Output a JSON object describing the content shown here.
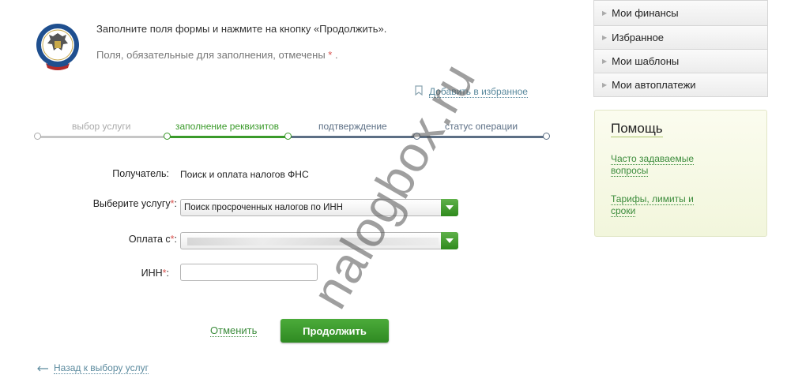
{
  "intro": {
    "line1": "Заполните поля формы и нажмите на кнопку «Продолжить».",
    "line2": "Поля, обязательные для заполнения, отмечены",
    "req_mark": "*",
    "dot": "."
  },
  "favorite": {
    "label": "Добавить в избранное",
    "icon": "bookmark-icon"
  },
  "stepper": {
    "steps": [
      "выбор услуги",
      "заполнение реквизитов",
      "подтверждение",
      "статус операции"
    ],
    "active_index": 1,
    "colors": {
      "done": "#bbbbbb",
      "active": "#3a9a2a",
      "pending": "#5c6f85"
    }
  },
  "form": {
    "recipient_label": "Получатель:",
    "recipient_value": "Поиск и оплата налогов ФНС",
    "service_label": "Выберите услугу",
    "service_value": "Поиск просроченных налогов по ИНН",
    "payment_label": "Оплата с",
    "inn_label": "ИНН",
    "req_mark": "*",
    "colon": ":"
  },
  "actions": {
    "cancel": "Отменить",
    "continue": "Продолжить",
    "back": "Назад к выбору услуг"
  },
  "menu": {
    "items": [
      "Мои финансы",
      "Избранное",
      "Мои шаблоны",
      "Мои автоплатежи"
    ]
  },
  "help": {
    "title": "Помощь",
    "faq_line1": "Часто задаваемые",
    "faq_line2": "вопросы",
    "tariffs_line1": "Тарифы, лимиты и",
    "tariffs_line2": "сроки"
  },
  "watermark": "nalogbox.ru",
  "colors": {
    "accent_green": "#2f8a22",
    "link_blue": "#5b8a9e",
    "required": "#d9534f"
  }
}
